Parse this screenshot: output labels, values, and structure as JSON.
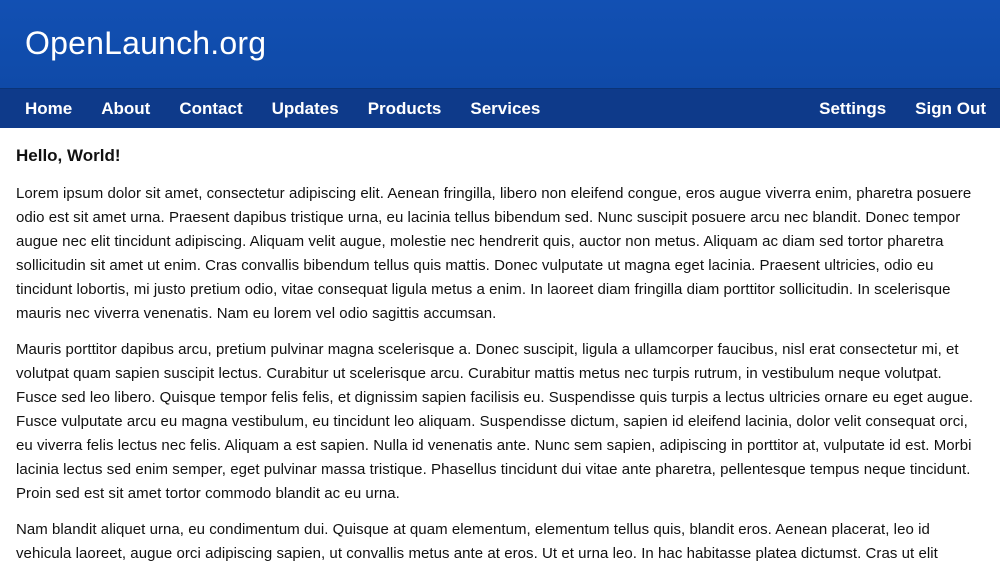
{
  "header": {
    "site_title": "OpenLaunch.org"
  },
  "nav": {
    "left": [
      "Home",
      "About",
      "Contact",
      "Updates",
      "Products",
      "Services"
    ],
    "right": [
      "Settings",
      "Sign Out"
    ]
  },
  "main": {
    "heading": "Hello, World!",
    "paragraphs": [
      "Lorem ipsum dolor sit amet, consectetur adipiscing elit. Aenean fringilla, libero non eleifend congue, eros augue viverra enim, pharetra posuere odio est sit amet urna. Praesent dapibus tristique urna, eu lacinia tellus bibendum sed. Nunc suscipit posuere arcu nec blandit. Donec tempor augue nec elit tincidunt adipiscing. Aliquam velit augue, molestie nec hendrerit quis, auctor non metus. Aliquam ac diam sed tortor pharetra sollicitudin sit amet ut enim. Cras convallis bibendum tellus quis mattis. Donec vulputate ut magna eget lacinia. Praesent ultricies, odio eu tincidunt lobortis, mi justo pretium odio, vitae consequat ligula metus a enim. In laoreet diam fringilla diam porttitor sollicitudin. In scelerisque mauris nec viverra venenatis. Nam eu lorem vel odio sagittis accumsan.",
      "Mauris porttitor dapibus arcu, pretium pulvinar magna scelerisque a. Donec suscipit, ligula a ullamcorper faucibus, nisl erat consectetur mi, et volutpat quam sapien suscipit lectus. Curabitur ut scelerisque arcu. Curabitur mattis metus nec turpis rutrum, in vestibulum neque volutpat. Fusce sed leo libero. Quisque tempor felis felis, et dignissim sapien facilisis eu. Suspendisse quis turpis a lectus ultricies ornare eu eget augue. Fusce vulputate arcu eu magna vestibulum, eu tincidunt leo aliquam. Suspendisse dictum, sapien id eleifend lacinia, dolor velit consequat orci, eu viverra felis lectus nec felis. Aliquam a est sapien. Nulla id venenatis ante. Nunc sem sapien, adipiscing in porttitor at, vulputate id est. Morbi lacinia lectus sed enim semper, eget pulvinar massa tristique. Phasellus tincidunt dui vitae ante pharetra, pellentesque tempus neque tincidunt. Proin sed est sit amet tortor commodo blandit ac eu urna.",
      "Nam blandit aliquet urna, eu condimentum dui. Quisque at quam elementum, elementum tellus quis, blandit eros. Aenean placerat, leo id vehicula laoreet, augue orci adipiscing sapien, ut convallis metus ante at eros. Ut et urna leo. In hac habitasse platea dictumst. Cras ut elit"
    ]
  }
}
